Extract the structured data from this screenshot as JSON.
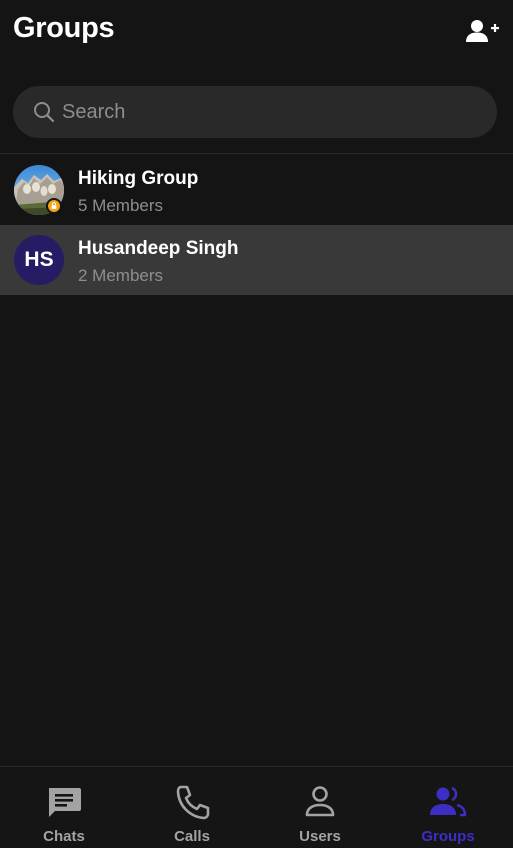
{
  "header": {
    "title": "Groups",
    "create_icon": "add-user-icon"
  },
  "search": {
    "placeholder": "Search",
    "value": ""
  },
  "groups": [
    {
      "name": "Hiking Group",
      "members": "5 Members",
      "avatar": "mountain-photo",
      "badge_icon": "lock-icon",
      "badge_color": "#f2a516",
      "selected": false
    },
    {
      "name": "Husandeep Singh",
      "members": "2 Members",
      "initials": "HS",
      "avatar_color": "#261c63",
      "selected": true
    }
  ],
  "nav": [
    {
      "label": "Chats",
      "icon": "chat-icon",
      "active": false
    },
    {
      "label": "Calls",
      "icon": "phone-icon",
      "active": false
    },
    {
      "label": "Users",
      "icon": "user-icon",
      "active": false
    },
    {
      "label": "Groups",
      "icon": "groups-icon",
      "active": true
    }
  ],
  "colors": {
    "background": "#141414",
    "accent": "#3d2ec4",
    "selected_row": "#393939",
    "muted_text": "#8e8e8e"
  }
}
